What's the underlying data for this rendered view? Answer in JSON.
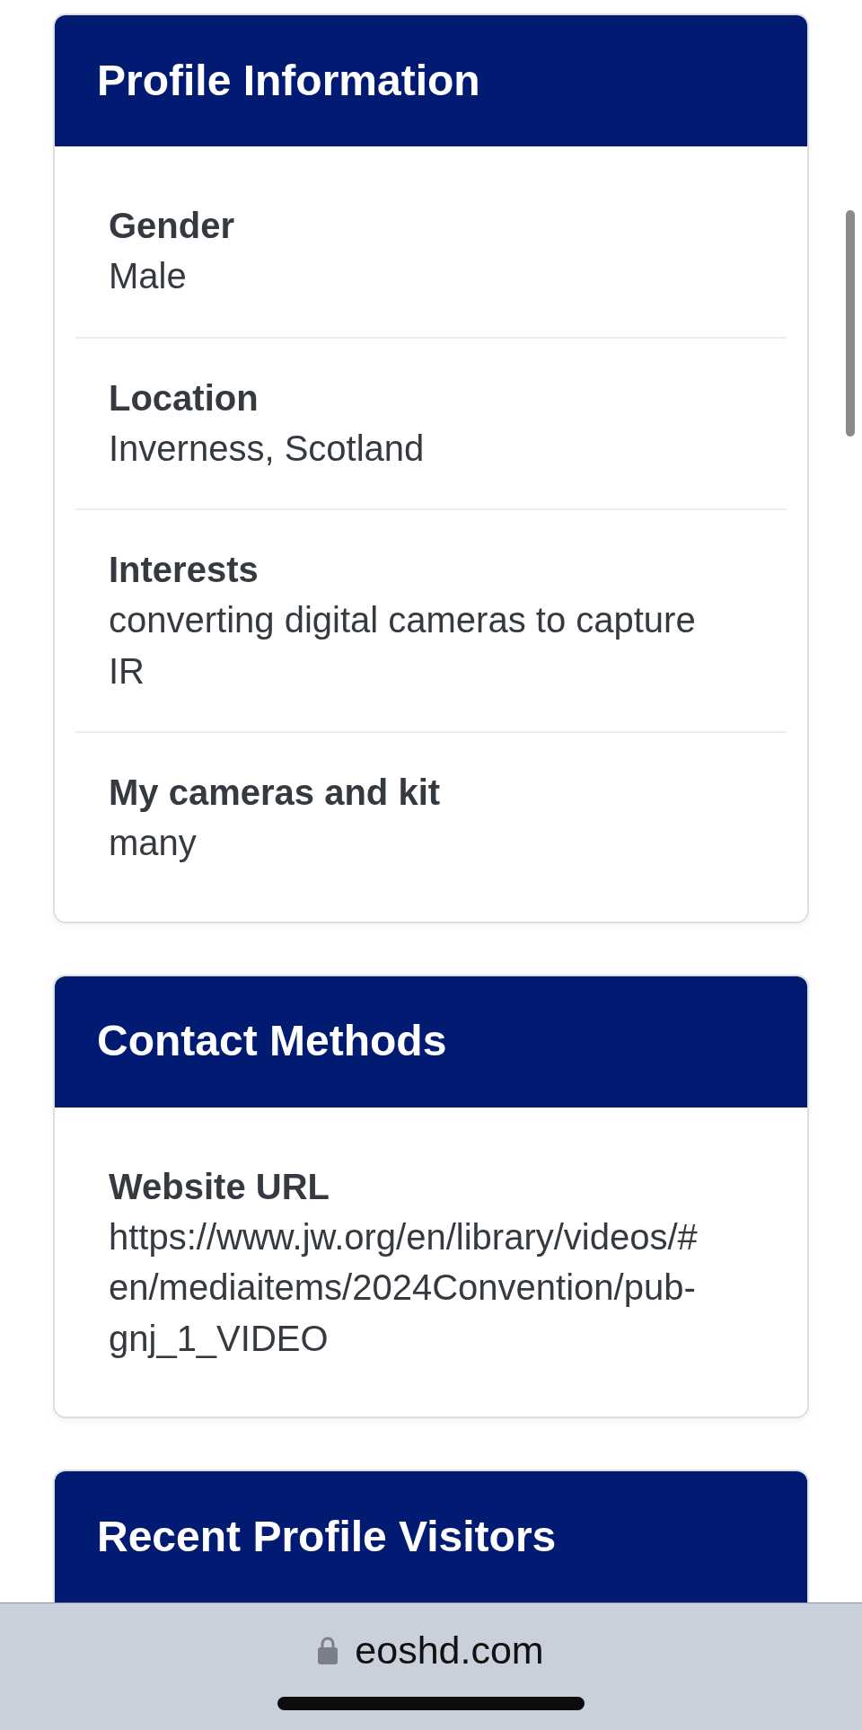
{
  "sections": [
    {
      "title": "Profile Information",
      "fields": [
        {
          "label": "Gender",
          "value": "Male"
        },
        {
          "label": "Location",
          "value": "Inverness, Scotland"
        },
        {
          "label": "Interests",
          "value": "converting digital cameras to capture IR"
        },
        {
          "label": "My cameras and kit",
          "value": "many"
        }
      ]
    },
    {
      "title": "Contact Methods",
      "fields": [
        {
          "label": "Website URL",
          "value": "https://www.jw.org/en/library/videos/#en/mediaitems/2024Convention/pub-gnj_1_VIDEO"
        }
      ]
    },
    {
      "title": "Recent Profile Visitors"
    }
  ],
  "browser": {
    "address": "eoshd.com",
    "secure": true
  }
}
